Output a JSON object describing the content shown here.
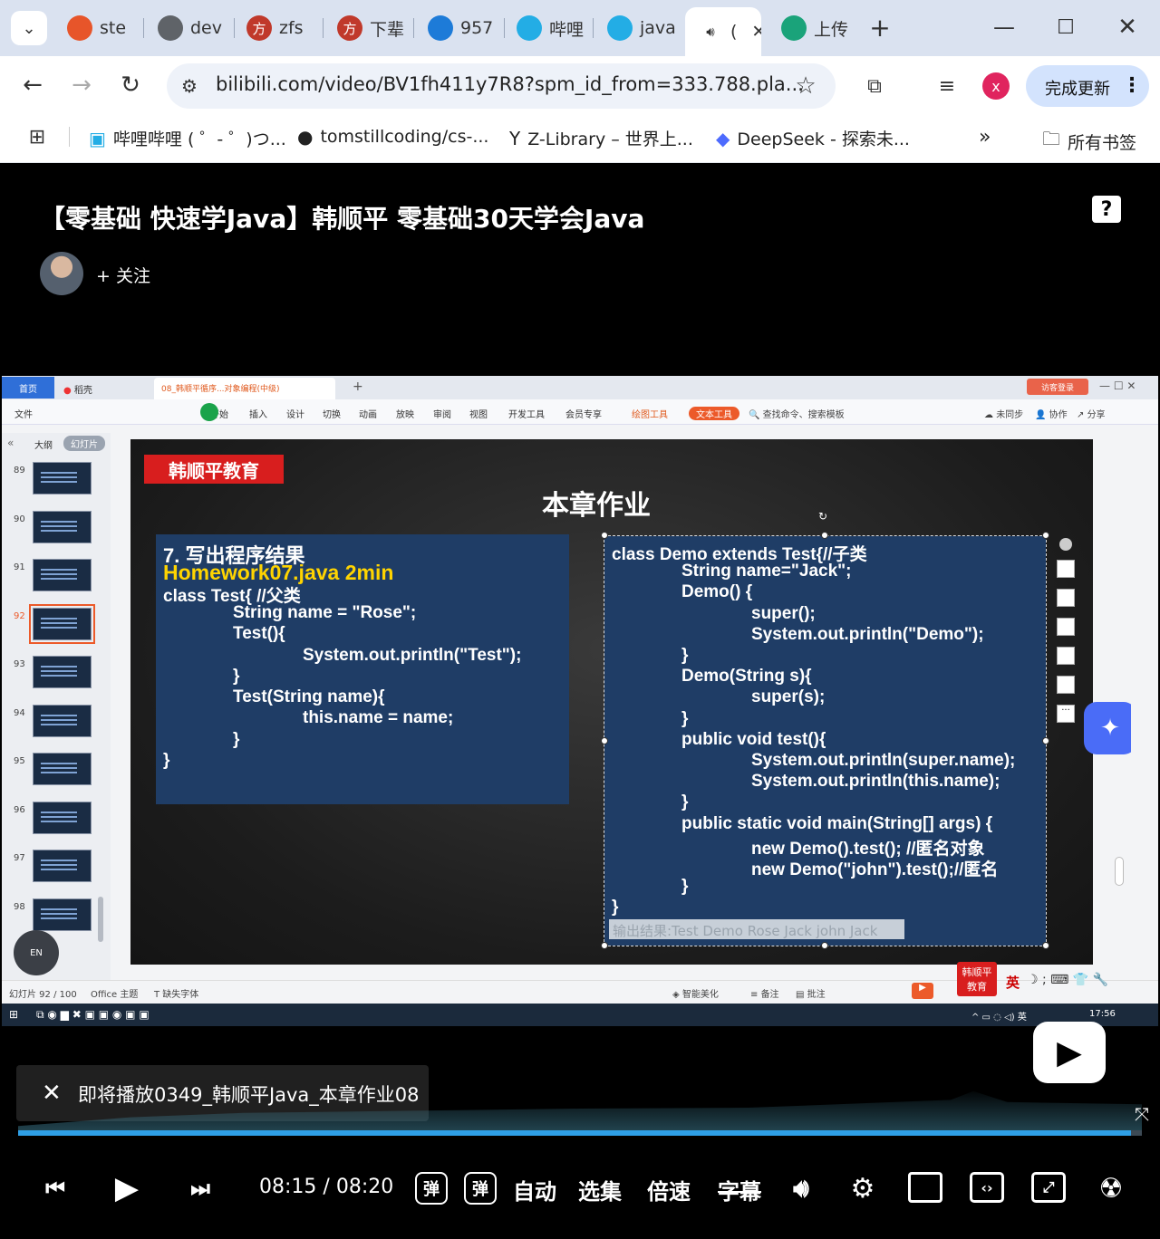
{
  "browser": {
    "tabs": [
      {
        "label": "ste",
        "icon": "chrome-icon",
        "color": "#e7552a"
      },
      {
        "label": "dev",
        "icon": "globe-icon",
        "color": "#5f6368"
      },
      {
        "label": "zfs",
        "icon": "fang-icon",
        "color": "#c0392b",
        "glyph": "方"
      },
      {
        "label": "下辈",
        "icon": "fang-icon",
        "color": "#c0392b",
        "glyph": "方"
      },
      {
        "label": "957",
        "icon": "edge-icon",
        "color": "#1d7bd8"
      },
      {
        "label": "哔哩",
        "icon": "bilibili-icon",
        "color": "#23ade5"
      },
      {
        "label": "java",
        "icon": "bilibili-icon",
        "color": "#23ade5"
      },
      {
        "label": "(",
        "icon": "speaker-icon",
        "active": true
      },
      {
        "label": "上传",
        "icon": "upload-icon",
        "color": "#1aa37a"
      }
    ],
    "url": "bilibili.com/video/BV1fh411y7R8?spm_id_from=333.788.pla...",
    "profile_initial": "x",
    "update_button": "完成更新",
    "bookmarks": [
      {
        "label": "哔哩哔哩 ( ゜- ゜)つ...",
        "icon": "bilibili-icon"
      },
      {
        "label": "tomstillcoding/cs-...",
        "icon": "github-icon"
      },
      {
        "label": "Z-Library – 世界上...",
        "icon": "zlibrary-icon"
      },
      {
        "label": "DeepSeek - 探索未...",
        "icon": "deepseek-icon"
      }
    ],
    "all_bookmarks": "所有书签",
    "more": "»"
  },
  "video": {
    "title": "【零基础 快速学Java】韩顺平 零基础30天学会Java",
    "follow": "+ 关注"
  },
  "wps": {
    "tabs": [
      "首页",
      "稻壳",
      "08_韩顺平循序...对象编程(中级)"
    ],
    "login": "访客登录",
    "menu": [
      "文件",
      "开始",
      "插入",
      "设计",
      "切换",
      "动画",
      "放映",
      "审阅",
      "视图",
      "开发工具",
      "会员专享",
      "绘图工具",
      "文本工具"
    ],
    "search": "查找命令、搜索模板",
    "sync": "未同步",
    "collab": "协作",
    "share": "分享",
    "panel_tabs": [
      "大纲",
      "幻灯片"
    ],
    "thumb_numbers": [
      "89",
      "90",
      "91",
      "92",
      "93",
      "94",
      "95",
      "96",
      "97",
      "98"
    ],
    "status": {
      "slide_count": "幻灯片 92 / 100",
      "theme": "Office 主题",
      "font": "缺失字体",
      "beautify": "智能美化",
      "notes": "备注",
      "comments": "批注",
      "ime": "英"
    },
    "clock": "17:56"
  },
  "slide": {
    "logo": "韩顺平教育",
    "heading": "本章作业",
    "left_lines": [
      {
        "text": "7. 写出程序结果",
        "indent": 0,
        "yellow": false
      },
      {
        "text": "Homework07.java 2min",
        "indent": 0,
        "yellow": true
      },
      {
        "text": "class Test{ //父类",
        "indent": 0
      },
      {
        "text": "String name = \"Rose\";",
        "indent": 1
      },
      {
        "text": "Test(){",
        "indent": 1
      },
      {
        "text": "System.out.println(\"Test\");",
        "indent": 2
      },
      {
        "text": "}",
        "indent": 1
      },
      {
        "text": "Test(String name){",
        "indent": 1
      },
      {
        "text": "this.name = name;",
        "indent": 2
      },
      {
        "text": "}",
        "indent": 1
      },
      {
        "text": "}",
        "indent": 0
      }
    ],
    "right_lines": [
      {
        "text": "class Demo extends Test{//子类",
        "indent": 0
      },
      {
        "text": "String name=\"Jack\";",
        "indent": 1
      },
      {
        "text": "Demo() {",
        "indent": 1
      },
      {
        "text": "super();",
        "indent": 2
      },
      {
        "text": "System.out.println(\"Demo\");",
        "indent": 2
      },
      {
        "text": "}",
        "indent": 1
      },
      {
        "text": "Demo(String s){",
        "indent": 1
      },
      {
        "text": "super(s);",
        "indent": 2
      },
      {
        "text": "}",
        "indent": 1
      },
      {
        "text": "public void test(){",
        "indent": 1
      },
      {
        "text": "System.out.println(super.name);",
        "indent": 2
      },
      {
        "text": "System.out.println(this.name);",
        "indent": 2
      },
      {
        "text": "}",
        "indent": 1
      },
      {
        "text": "public static void main(String[] args)     {",
        "indent": 1
      },
      {
        "text": "new Demo().test(); //匿名对象",
        "indent": 2
      },
      {
        "text": "new Demo(\"john\").test();//匿名",
        "indent": 2
      },
      {
        "text": "}",
        "indent": 1
      },
      {
        "text": "}",
        "indent": 0
      }
    ],
    "answer": "输出结果:Test Demo Rose Jack john Jack"
  },
  "player": {
    "up_next": "即将播放0349_韩顺平Java_本章作业08",
    "current_time": "08:15",
    "separator": "/",
    "total_time": "08:20",
    "progress": 0.99,
    "auto": "自动",
    "episodes": "选集",
    "speed": "倍速",
    "subtitle": "字幕",
    "danmaku_1": "弹",
    "danmaku_2": "弹"
  }
}
